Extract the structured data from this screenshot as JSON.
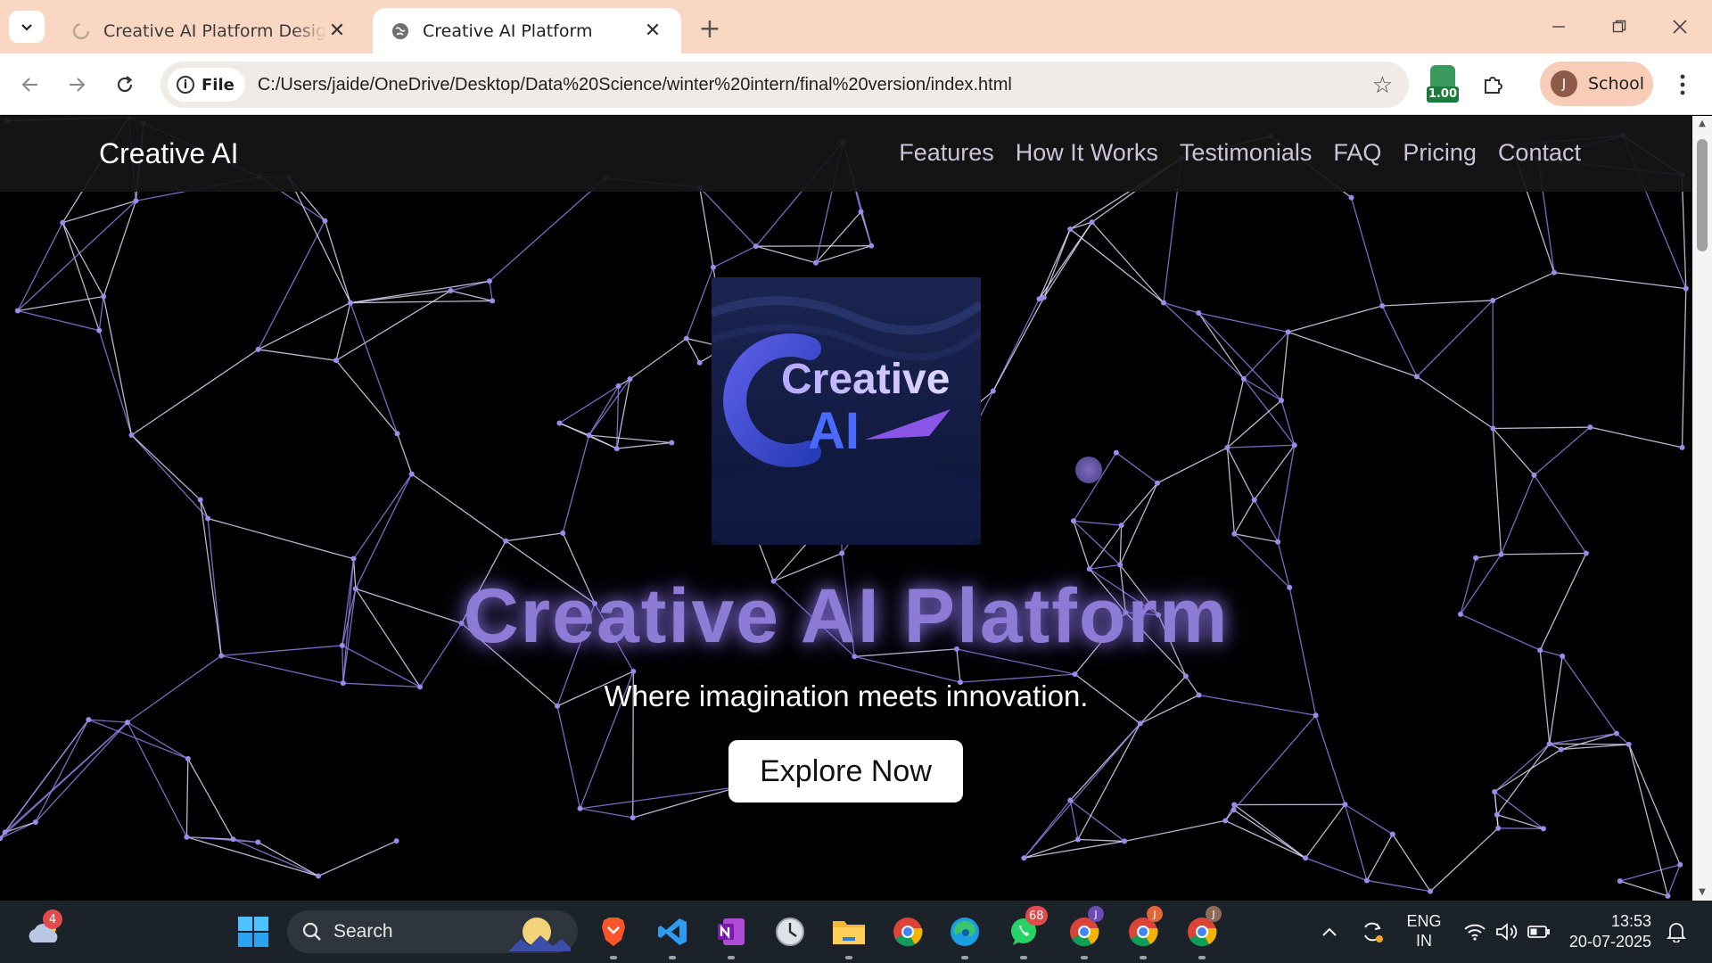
{
  "browser": {
    "tabs": [
      {
        "title": "Creative AI Platform Design - G",
        "active": false
      },
      {
        "title": "Creative AI Platform",
        "active": true
      }
    ],
    "site_chip": "File",
    "url": "C:/Users/jaide/OneDrive/Desktop/Data%20Science/winter%20intern/final%20version/index.html",
    "extension_badge": "1.00",
    "profile_initial": "J",
    "profile_name": "School"
  },
  "page": {
    "brand": "Creative AI",
    "nav": [
      "Features",
      "How It Works",
      "Testimonials",
      "FAQ",
      "Pricing",
      "Contact"
    ],
    "logo_text_line1": "Creative",
    "logo_text_line2": "AI",
    "hero_title": "Creative AI Platform",
    "hero_subtitle": "Where imagination meets innovation.",
    "cta_label": "Explore Now",
    "accent_color": "#8d7bd6"
  },
  "taskbar": {
    "weather_badge": "4",
    "search_label": "Search",
    "whatsapp_badge": "68",
    "chrome_profile_initial": "J",
    "lang_line1": "ENG",
    "lang_line2": "IN",
    "time": "13:53",
    "date": "20-07-2025"
  }
}
